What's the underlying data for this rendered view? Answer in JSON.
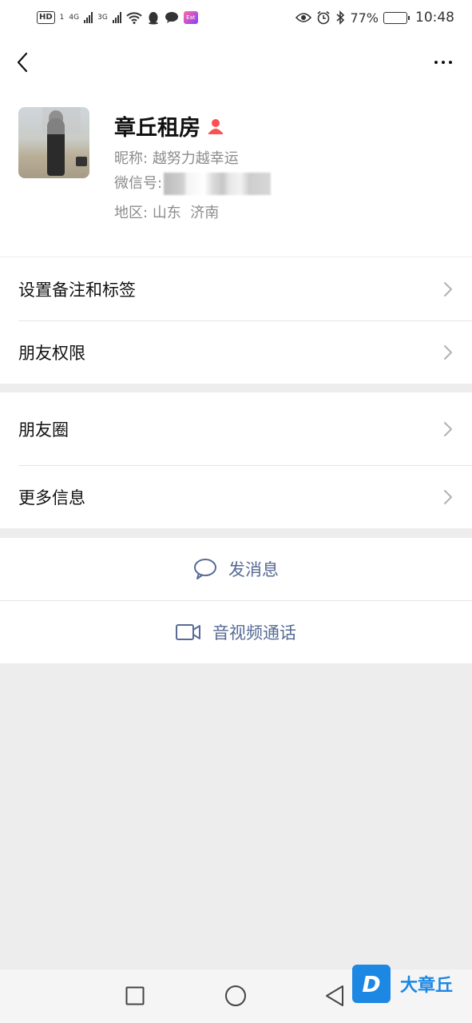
{
  "status_bar": {
    "hd_label": "HD",
    "sim_label": "1",
    "network_1": "4G",
    "network_2": "3G",
    "app_tile": "Eat",
    "battery": "77%",
    "battery_level": 0.77,
    "time": "10:48"
  },
  "profile": {
    "name": "章丘租房",
    "nickname_label": "昵称:",
    "nickname": "越努力越幸运",
    "wechat_id_label": "微信号:",
    "region_label": "地区:",
    "region": "山东  济南",
    "gender_icon": "female-icon",
    "gender_color": "#fa5151"
  },
  "menu_group_1": [
    {
      "label": "设置备注和标签"
    },
    {
      "label": "朋友权限"
    }
  ],
  "menu_group_2": [
    {
      "label": "朋友圈"
    },
    {
      "label": "更多信息"
    }
  ],
  "actions": {
    "send_message": "发消息",
    "av_call": "音视频通话",
    "link_color": "#576b95"
  },
  "watermark": {
    "logo_letter": "D",
    "text": "大章丘",
    "color": "#1d87e4"
  }
}
